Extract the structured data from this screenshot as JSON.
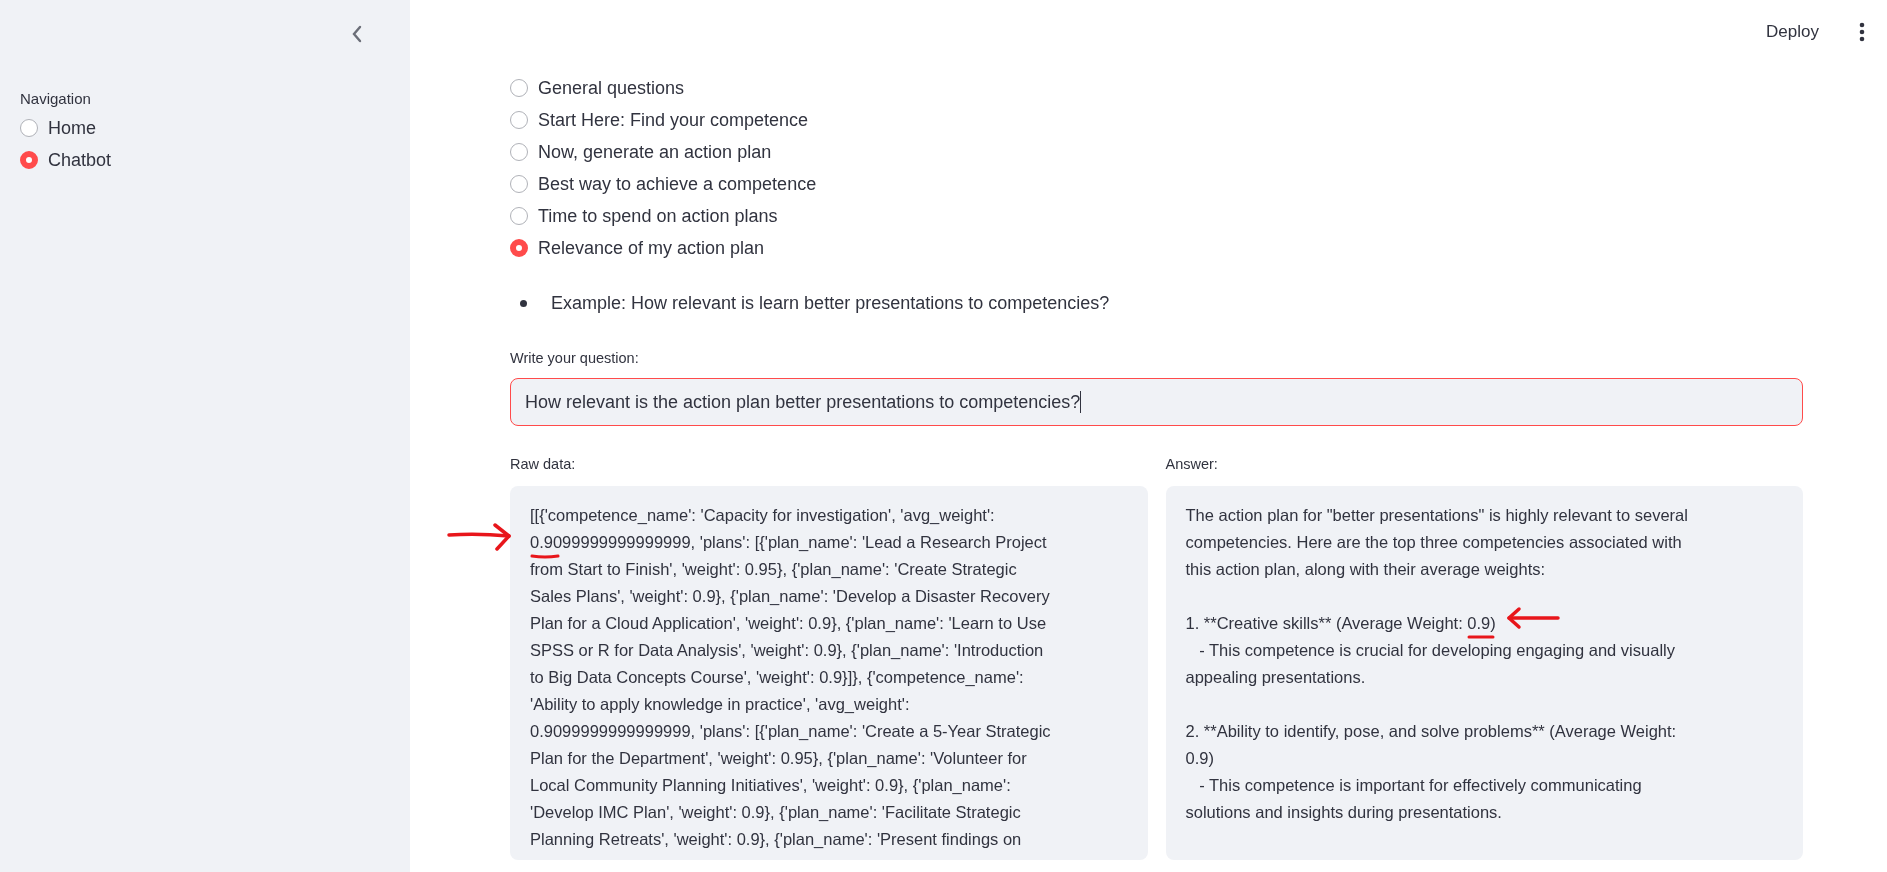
{
  "header": {
    "deploy": "Deploy"
  },
  "sidebar": {
    "navigation": {
      "label": "Navigation",
      "options": [
        {
          "label": "Home",
          "selected": false
        },
        {
          "label": "Chatbot",
          "selected": true
        }
      ]
    }
  },
  "topics": [
    {
      "label": "General questions",
      "selected": false
    },
    {
      "label": "Start Here: Find your competence",
      "selected": false
    },
    {
      "label": "Now, generate an action plan",
      "selected": false
    },
    {
      "label": "Best way to achieve a competence",
      "selected": false
    },
    {
      "label": "Time to spend on action plans",
      "selected": false
    },
    {
      "label": "Relevance of my action plan",
      "selected": true
    }
  ],
  "example": "Example: How relevant is learn better presentations to competencies?",
  "question": {
    "label": "Write your question:",
    "value": "How relevant is the action plan better presentations to competencies?"
  },
  "raw_data": {
    "label": "Raw data:",
    "lines": [
      "[[{'competence_name': 'Capacity for investigation', 'avg_weight':",
      "0.9099999999999999, 'plans': [{'plan_name': 'Lead a Research Project",
      "from Start to Finish', 'weight': 0.95}, {'plan_name': 'Create Strategic",
      "Sales Plans', 'weight': 0.9}, {'plan_name': 'Develop a Disaster Recovery",
      "Plan for a Cloud Application', 'weight': 0.9}, {'plan_name': 'Learn to Use",
      "SPSS or R for Data Analysis', 'weight': 0.9}, {'plan_name': 'Introduction",
      "to Big Data Concepts Course', 'weight': 0.9}]}, {'competence_name':",
      "'Ability to apply knowledge in practice', 'avg_weight':",
      "0.9099999999999999, 'plans': [{'plan_name': 'Create a 5-Year Strategic",
      "Plan for the Department', 'weight': 0.95}, {'plan_name': 'Volunteer for",
      "Local Community Planning Initiatives', 'weight': 0.9}, {'plan_name':",
      "'Develop IMC Plan', 'weight': 0.9}, {'plan_name': 'Facilitate Strategic",
      "Planning Retreats', 'weight': 0.9}, {'plan_name': 'Present findings on"
    ]
  },
  "answer": {
    "label": "Answer:",
    "paragraphs": [
      [
        "The action plan for \"better presentations\" is highly relevant to several",
        "competencies. Here are the top three competencies associated with",
        "this action plan, along with their average weights:"
      ],
      [
        "1. **Creative skills** (Average Weight: 0.9)",
        "   - This competence is crucial for developing engaging and visually",
        "appealing presentations."
      ],
      [
        "2. **Ability to identify, pose, and solve problems** (Average Weight:",
        "0.9)",
        "   - This competence is important for effectively communicating",
        "solutions and insights during presentations."
      ]
    ]
  }
}
